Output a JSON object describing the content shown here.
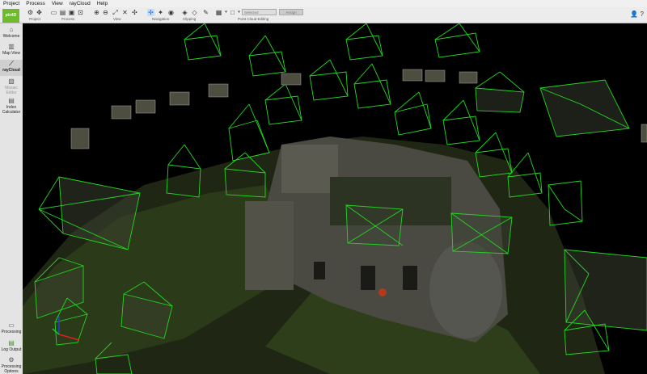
{
  "menu": [
    "Project",
    "Process",
    "View",
    "rayCloud",
    "Help"
  ],
  "logo_text": "pix4D",
  "toolbar_groups": [
    "Project",
    "Process",
    "View",
    "Navigation",
    "Clipping",
    "Point Cloud Editing"
  ],
  "point_cloud_editing": {
    "class_select": "Selected",
    "assign_button": "Assign"
  },
  "sidebar": {
    "welcome": "Welcome",
    "map_view": "Map View",
    "raycloud": "rayCloud",
    "mosaic_editor": "Mosaic Editor",
    "index_calculator": "Index Calculator",
    "processing": "Processing",
    "log_output": "Log Output",
    "processing_options": "Processing Options"
  },
  "colors": {
    "camera_frustum": "#22d822",
    "sidebar_bg": "#e4e4e4",
    "toolbar_bg": "#ececec",
    "logo": "#6dbb2d"
  }
}
